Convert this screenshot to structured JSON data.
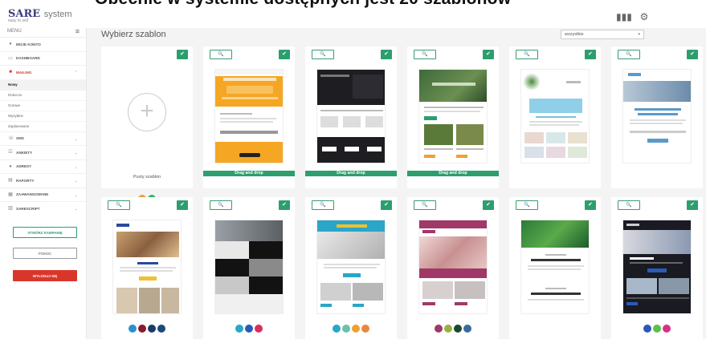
{
  "heading": "Obecnie w systemie dostępnych jest 20 szablonów",
  "topbar": {
    "brand": "SARE",
    "brand_suffix": "system",
    "tagline": "easy to sell",
    "icons": [
      "grid-icon",
      "gear-icon"
    ]
  },
  "sidebar": {
    "menu_label": "MENU",
    "items": [
      {
        "label": "MOJE KONTO",
        "icon": "user-icon"
      },
      {
        "label": "DASHBOARD",
        "icon": "dashboard-icon"
      },
      {
        "label": "MAILING",
        "icon": "mail-icon",
        "active": true
      },
      {
        "label": "SMS",
        "icon": "phone-icon"
      },
      {
        "label": "ANKIETY",
        "icon": "check-icon"
      },
      {
        "label": "ADRESY",
        "icon": "user-icon"
      },
      {
        "label": "RAPORTY",
        "icon": "chart-icon"
      },
      {
        "label": "ZAAWANSOWANE",
        "icon": "settings-icon"
      },
      {
        "label": "SARESCRIPT",
        "icon": "code-icon"
      }
    ],
    "subitems": [
      "Nowy",
      "Robocze",
      "Gotowe",
      "Wysyłane",
      "Zaplanowane"
    ],
    "buttons": {
      "create": "STWÓRZ KAMPANIĘ",
      "help": "POMOC",
      "logout": "WYLOGUJ SIĘ"
    }
  },
  "main": {
    "title": "Wybierz szablon",
    "filter_value": "wszystkie",
    "empty_card_label": "Pusty szablon",
    "drag_label": "Drag and drop",
    "row1": [
      {
        "name": "empty",
        "swatches": [
          "#f0a030",
          "#2fb36a"
        ]
      },
      {
        "name": "countdown",
        "drag": true,
        "swatches": []
      },
      {
        "name": "dark-newsletter",
        "drag": true,
        "swatches": []
      },
      {
        "name": "nature",
        "drag": true,
        "swatches": []
      },
      {
        "name": "spa",
        "swatches": []
      },
      {
        "name": "business",
        "swatches": []
      }
    ],
    "row2": [
      {
        "name": "gifts",
        "swatches": [
          "#2a90d0",
          "#8b1a2b",
          "#1e3a6a",
          "#1a4a7a"
        ]
      },
      {
        "name": "interior",
        "swatches": [
          "#2aa6c8",
          "#2a5ab8",
          "#d92e5a"
        ]
      },
      {
        "name": "laptop",
        "swatches": [
          "#2aa6c8",
          "#6cc0a8",
          "#f0a030",
          "#e88840"
        ]
      },
      {
        "name": "shopping",
        "swatches": [
          "#a03868",
          "#98b040",
          "#1a4a2a",
          "#3a6a9a"
        ]
      },
      {
        "name": "leaves",
        "swatches": []
      },
      {
        "name": "tech",
        "swatches": [
          "#2a5ab8",
          "#5ac04a",
          "#d92e8a"
        ]
      }
    ]
  },
  "colors": {
    "accent": "#2d9e6e",
    "brand_red": "#d9362b",
    "brand_blue": "#3a3d80"
  }
}
